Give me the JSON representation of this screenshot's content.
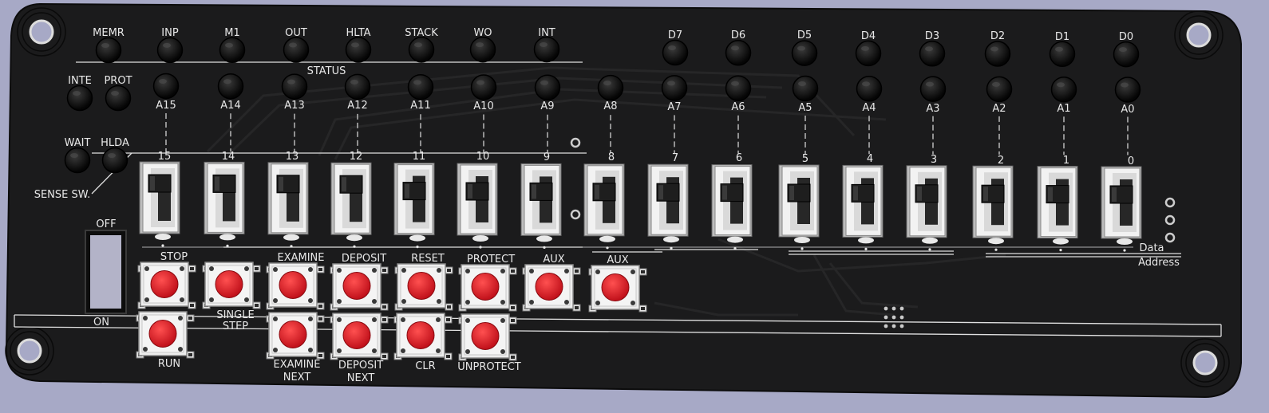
{
  "status_leds": [
    "MEMR",
    "INP",
    "M1",
    "OUT",
    "HLTA",
    "STACK",
    "WO",
    "INT"
  ],
  "status_title": "STATUS",
  "side_leds": [
    "INTE",
    "PROT",
    "WAIT",
    "HLDA"
  ],
  "data_leds": [
    "D7",
    "D6",
    "D5",
    "D4",
    "D3",
    "D2",
    "D1",
    "D0"
  ],
  "address_leds": [
    "A15",
    "A14",
    "A13",
    "A12",
    "A11",
    "A10",
    "A9",
    "A8",
    "A7",
    "A6",
    "A5",
    "A4",
    "A3",
    "A2",
    "A1",
    "A0"
  ],
  "switch_numbers": [
    "15",
    "14",
    "13",
    "12",
    "11",
    "10",
    "9",
    "8",
    "7",
    "6",
    "5",
    "4",
    "3",
    "2",
    "1",
    "0"
  ],
  "sense_label": "SENSE SW.",
  "power": {
    "off_label": "OFF",
    "on_label": "ON"
  },
  "buttons_top": [
    "STOP",
    "",
    "EXAMINE",
    "DEPOSIT",
    "RESET",
    "PROTECT",
    "AUX",
    "AUX"
  ],
  "single_step": [
    "SINGLE",
    "STEP"
  ],
  "buttons_bottom": [
    "RUN",
    "",
    "EXAMINE",
    "DEPOSIT",
    "CLR",
    "UNPROTECT"
  ],
  "bottom_second_line": [
    "NEXT",
    "NEXT"
  ],
  "right_labels": {
    "data": "Data",
    "address": "Address"
  },
  "colors": {
    "pcb": "#1b1b1c",
    "background": "#a7a9c6",
    "button": "#e01820",
    "switch_body": "#f2f2f2",
    "silkscreen": "#e8e8e8"
  }
}
